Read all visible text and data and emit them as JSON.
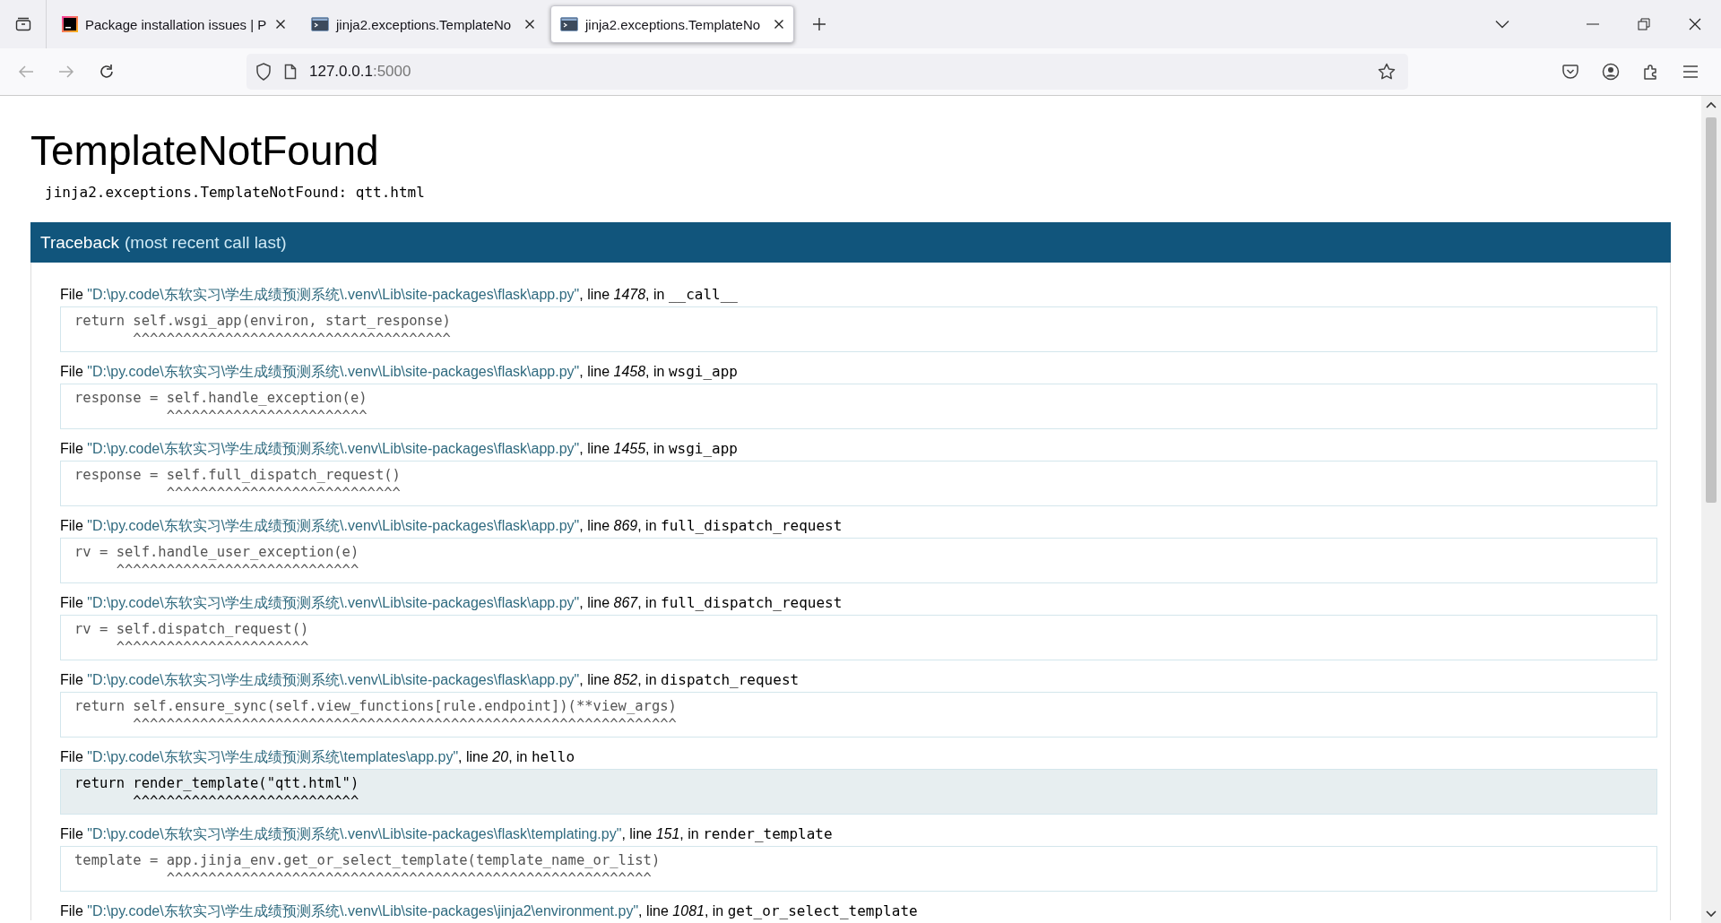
{
  "browser": {
    "tabs": [
      {
        "title": "Package installation issues | P",
        "selected": false
      },
      {
        "title": "jinja2.exceptions.TemplateNo",
        "selected": false
      },
      {
        "title": "jinja2.exceptions.TemplateNo",
        "selected": true
      }
    ],
    "address": {
      "host": "127.0.0.1",
      "port": ":5000"
    }
  },
  "page": {
    "title": "TemplateNotFound",
    "exception": "jinja2.exceptions.TemplateNotFound: qtt.html",
    "traceback": {
      "title": "Traceback",
      "note": "(most recent call last)"
    },
    "frames": [
      {
        "kind": "library",
        "label_file": "File",
        "path": "\"D:\\py.code\\东软实习\\学生成绩预测系统\\.venv\\Lib\\site-packages\\flask\\app.py\"",
        "label_line": ", line",
        "line": "1478",
        "label_in": ", in",
        "function": "__call__",
        "code": "return self.wsgi_app(environ, start_response)",
        "carets": "       ^^^^^^^^^^^^^^^^^^^^^^^^^^^^^^^^^^^^^^"
      },
      {
        "kind": "library",
        "label_file": "File",
        "path": "\"D:\\py.code\\东软实习\\学生成绩预测系统\\.venv\\Lib\\site-packages\\flask\\app.py\"",
        "label_line": ", line",
        "line": "1458",
        "label_in": ", in",
        "function": "wsgi_app",
        "code": "response = self.handle_exception(e)",
        "carets": "           ^^^^^^^^^^^^^^^^^^^^^^^^"
      },
      {
        "kind": "library",
        "label_file": "File",
        "path": "\"D:\\py.code\\东软实习\\学生成绩预测系统\\.venv\\Lib\\site-packages\\flask\\app.py\"",
        "label_line": ", line",
        "line": "1455",
        "label_in": ", in",
        "function": "wsgi_app",
        "code": "response = self.full_dispatch_request()",
        "carets": "           ^^^^^^^^^^^^^^^^^^^^^^^^^^^^"
      },
      {
        "kind": "library",
        "label_file": "File",
        "path": "\"D:\\py.code\\东软实习\\学生成绩预测系统\\.venv\\Lib\\site-packages\\flask\\app.py\"",
        "label_line": ", line",
        "line": "869",
        "label_in": ", in",
        "function": "full_dispatch_request",
        "code": "rv = self.handle_user_exception(e)",
        "carets": "     ^^^^^^^^^^^^^^^^^^^^^^^^^^^^^"
      },
      {
        "kind": "library",
        "label_file": "File",
        "path": "\"D:\\py.code\\东软实习\\学生成绩预测系统\\.venv\\Lib\\site-packages\\flask\\app.py\"",
        "label_line": ", line",
        "line": "867",
        "label_in": ", in",
        "function": "full_dispatch_request",
        "code": "rv = self.dispatch_request()",
        "carets": "     ^^^^^^^^^^^^^^^^^^^^^^^"
      },
      {
        "kind": "library",
        "label_file": "File",
        "path": "\"D:\\py.code\\东软实习\\学生成绩预测系统\\.venv\\Lib\\site-packages\\flask\\app.py\"",
        "label_line": ", line",
        "line": "852",
        "label_in": ", in",
        "function": "dispatch_request",
        "code": "return self.ensure_sync(self.view_functions[rule.endpoint])(**view_args)",
        "carets": "       ^^^^^^^^^^^^^^^^^^^^^^^^^^^^^^^^^^^^^^^^^^^^^^^^^^^^^^^^^^^^^^^^^"
      },
      {
        "kind": "app",
        "label_file": "File",
        "path": "\"D:\\py.code\\东软实习\\学生成绩预测系统\\templates\\app.py\"",
        "label_line": ", line",
        "line": "20",
        "label_in": ", in",
        "function": "hello",
        "code": "return render_template(\"qtt.html\")",
        "carets": "       ^^^^^^^^^^^^^^^^^^^^^^^^^^^"
      },
      {
        "kind": "library",
        "label_file": "File",
        "path": "\"D:\\py.code\\东软实习\\学生成绩预测系统\\.venv\\Lib\\site-packages\\flask\\templating.py\"",
        "label_line": ", line",
        "line": "151",
        "label_in": ", in",
        "function": "render_template",
        "code": "template = app.jinja_env.get_or_select_template(template_name_or_list)",
        "carets": "           ^^^^^^^^^^^^^^^^^^^^^^^^^^^^^^^^^^^^^^^^^^^^^^^^^^^^^^^^^^"
      },
      {
        "label_file": "File",
        "path": "\"D:\\py.code\\东软实习\\学生成绩预测系统\\.venv\\Lib\\site-packages\\jinja2\\environment.py\"",
        "label_line": ", line",
        "line": "1081",
        "label_in": ", in",
        "function": "get_or_select_template"
      }
    ]
  }
}
